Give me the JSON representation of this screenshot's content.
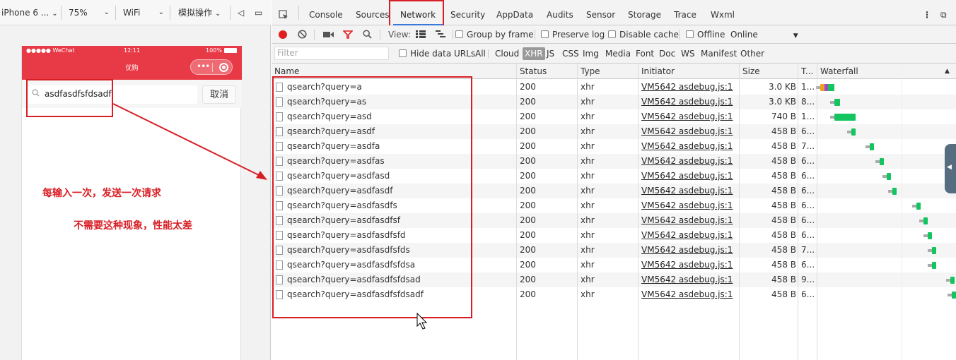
{
  "simulator": {
    "device": "iPhone 6 ...",
    "zoom": "75%",
    "network": "WiFi",
    "mode": "模拟操作"
  },
  "phone": {
    "carrier": "●●●●● WeChat",
    "time": "12:11",
    "battery": "100%",
    "title": "优购",
    "search_value": "asdfasdfsfdsadf",
    "cancel_label": "取消"
  },
  "annotations": {
    "note1": "每输入一次，发送一次请求",
    "note2": "不需要这种现象，性能太差"
  },
  "devtools": {
    "tabs": [
      "Console",
      "Sources",
      "Network",
      "Security",
      "AppData",
      "Audits",
      "Sensor",
      "Storage",
      "Trace",
      "Wxml"
    ],
    "active_tab": "Network",
    "toolbar": {
      "view_label": "View:",
      "group_by_frame": "Group by frame",
      "preserve_log": "Preserve log",
      "disable_cache": "Disable cache",
      "offline": "Offline",
      "online": "Online"
    },
    "filter": {
      "placeholder": "Filter",
      "hide_data_urls": "Hide data URLs",
      "types": [
        "All",
        "Cloud",
        "XHR",
        "JS",
        "CSS",
        "Img",
        "Media",
        "Font",
        "Doc",
        "WS",
        "Manifest",
        "Other"
      ],
      "selected_type": "XHR"
    },
    "columns": [
      "Name",
      "Status",
      "Type",
      "Initiator",
      "Size",
      "T...",
      "Waterfall"
    ],
    "rows": [
      {
        "name": "qsearch?query=a",
        "status": "200",
        "type": "xhr",
        "initiator": "VM5642 asdebug.js:1",
        "size": "3.0 KB",
        "time": "1..."
      },
      {
        "name": "qsearch?query=as",
        "status": "200",
        "type": "xhr",
        "initiator": "VM5642 asdebug.js:1",
        "size": "3.0 KB",
        "time": "8..."
      },
      {
        "name": "qsearch?query=asd",
        "status": "200",
        "type": "xhr",
        "initiator": "VM5642 asdebug.js:1",
        "size": "740 B",
        "time": "1..."
      },
      {
        "name": "qsearch?query=asdf",
        "status": "200",
        "type": "xhr",
        "initiator": "VM5642 asdebug.js:1",
        "size": "458 B",
        "time": "6..."
      },
      {
        "name": "qsearch?query=asdfa",
        "status": "200",
        "type": "xhr",
        "initiator": "VM5642 asdebug.js:1",
        "size": "458 B",
        "time": "7..."
      },
      {
        "name": "qsearch?query=asdfas",
        "status": "200",
        "type": "xhr",
        "initiator": "VM5642 asdebug.js:1",
        "size": "458 B",
        "time": "6..."
      },
      {
        "name": "qsearch?query=asdfasd",
        "status": "200",
        "type": "xhr",
        "initiator": "VM5642 asdebug.js:1",
        "size": "458 B",
        "time": "6..."
      },
      {
        "name": "qsearch?query=asdfasdf",
        "status": "200",
        "type": "xhr",
        "initiator": "VM5642 asdebug.js:1",
        "size": "458 B",
        "time": "6..."
      },
      {
        "name": "qsearch?query=asdfasdfs",
        "status": "200",
        "type": "xhr",
        "initiator": "VM5642 asdebug.js:1",
        "size": "458 B",
        "time": "6..."
      },
      {
        "name": "qsearch?query=asdfasdfsf",
        "status": "200",
        "type": "xhr",
        "initiator": "VM5642 asdebug.js:1",
        "size": "458 B",
        "time": "6..."
      },
      {
        "name": "qsearch?query=asdfasdfsfd",
        "status": "200",
        "type": "xhr",
        "initiator": "VM5642 asdebug.js:1",
        "size": "458 B",
        "time": "6..."
      },
      {
        "name": "qsearch?query=asdfasdfsfds",
        "status": "200",
        "type": "xhr",
        "initiator": "VM5642 asdebug.js:1",
        "size": "458 B",
        "time": "7..."
      },
      {
        "name": "qsearch?query=asdfasdfsfdsa",
        "status": "200",
        "type": "xhr",
        "initiator": "VM5642 asdebug.js:1",
        "size": "458 B",
        "time": "6..."
      },
      {
        "name": "qsearch?query=asdfasdfsfdsad",
        "status": "200",
        "type": "xhr",
        "initiator": "VM5642 asdebug.js:1",
        "size": "458 B",
        "time": "9..."
      },
      {
        "name": "qsearch?query=asdfasdfsfdsadf",
        "status": "200",
        "type": "xhr",
        "initiator": "VM5642 asdebug.js:1",
        "size": "458 B",
        "time": "6..."
      }
    ]
  },
  "colors": {
    "phone_header": "#e83a46",
    "annotation": "#d81e25",
    "waterfall_bar": "#12c55e",
    "active_tab_underline": "#3879d9"
  }
}
